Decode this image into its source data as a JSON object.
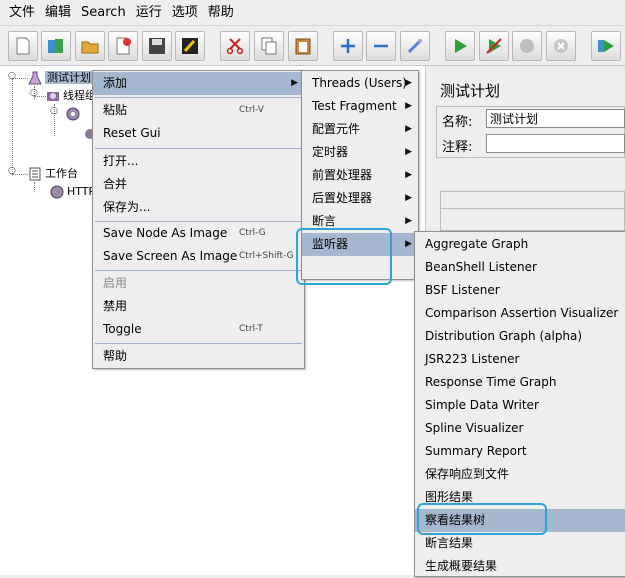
{
  "menubar": [
    "文件",
    "编辑",
    "Search",
    "运行",
    "选项",
    "帮助"
  ],
  "tree": {
    "test_plan": "测试计划",
    "thread_group": "线程组",
    "workbench": "工作台",
    "http": "HTTP"
  },
  "panel": {
    "title": "测试计划",
    "name_label": "名称:",
    "name_value": "测试计划",
    "comment_label": "注释:"
  },
  "context_menu": {
    "add": "添加",
    "paste": "粘贴",
    "paste_shortcut": "Ctrl-V",
    "reset_gui": "Reset Gui",
    "open": "打开...",
    "merge": "合并",
    "save_as": "保存为...",
    "save_node_image": "Save Node As Image",
    "save_node_image_shortcut": "Ctrl-G",
    "save_screen_image": "Save Screen As Image",
    "save_screen_image_shortcut": "Ctrl+Shift-G",
    "enable": "启用",
    "disable": "禁用",
    "toggle": "Toggle",
    "toggle_shortcut": "Ctrl-T",
    "help": "帮助"
  },
  "add_menu": {
    "threads": "Threads (Users)",
    "test_fragment": "Test Fragment",
    "config": "配置元件",
    "timer": "定时器",
    "pre_processor": "前置处理器",
    "post_processor": "后置处理器",
    "assertion": "断言",
    "listener": "监听器"
  },
  "listener_menu": [
    "Aggregate Graph",
    "BeanShell Listener",
    "BSF Listener",
    "Comparison Assertion Visualizer",
    "Distribution Graph (alpha)",
    "JSR223 Listener",
    "Response Time Graph",
    "Simple Data Writer",
    "Spline Visualizer",
    "Summary Report",
    "保存响应到文件",
    "图形结果",
    "察看结果树",
    "断言结果",
    "生成概要结果"
  ],
  "colors": {
    "selection": "#a5b8cf",
    "highlight_outline": "#2ea3d6"
  }
}
